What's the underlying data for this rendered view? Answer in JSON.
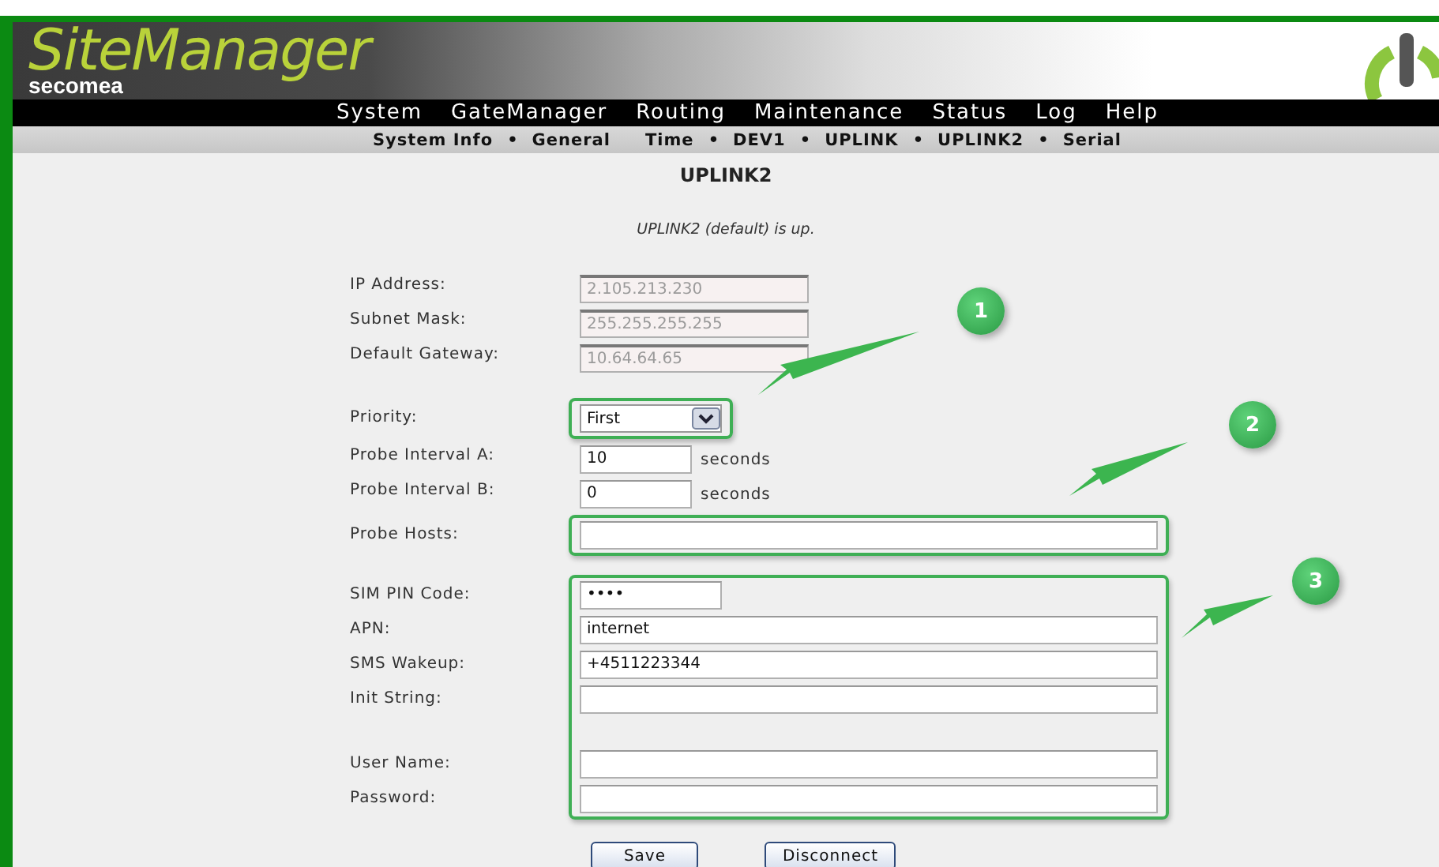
{
  "header": {
    "logo_title": "SiteManager",
    "logo_brand": "secomea"
  },
  "menu": [
    "System",
    "GateManager",
    "Routing",
    "Maintenance",
    "Status",
    "Log",
    "Help"
  ],
  "submenu": [
    {
      "label": "System Info"
    },
    {
      "label": "General",
      "bullet_before": "•"
    },
    {
      "label": "Time"
    },
    {
      "label": "DEV1",
      "bullet_before": "•"
    },
    {
      "label": "UPLINK",
      "bullet_before": "•"
    },
    {
      "label": "UPLINK2",
      "bullet_before": "•"
    },
    {
      "label": "Serial",
      "bullet_before": "•"
    }
  ],
  "page_title": "UPLINK2",
  "status_message": "UPLINK2 (default) is up.",
  "form_groups": [
    {
      "kind": "fields",
      "highlighted": false,
      "rows": [
        {
          "kind": "readonly",
          "label": "IP Address:",
          "value": "2.105.213.230"
        },
        {
          "kind": "readonly",
          "label": "Subnet Mask:",
          "value": "255.255.255.255"
        },
        {
          "kind": "readonly",
          "label": "Default Gateway:",
          "value": "10.64.64.65"
        }
      ]
    },
    {
      "kind": "spacer"
    },
    {
      "kind": "fields",
      "highlighted": true,
      "rows": [
        {
          "kind": "select",
          "label": "Priority:",
          "value": "First"
        }
      ]
    },
    {
      "kind": "fields",
      "highlighted": false,
      "rows": [
        {
          "kind": "interval",
          "label": "Probe Interval A:",
          "value": "10",
          "unit": "seconds"
        },
        {
          "kind": "interval",
          "label": "Probe Interval B:",
          "value": "0",
          "unit": "seconds"
        }
      ]
    },
    {
      "kind": "fields",
      "highlighted": true,
      "rows": [
        {
          "kind": "text",
          "label": "Probe Hosts:"
        }
      ]
    },
    {
      "kind": "spacer"
    },
    {
      "kind": "fields",
      "highlighted": true,
      "rows": [
        {
          "kind": "pin",
          "label": "SIM PIN Code:",
          "value": "••••"
        },
        {
          "kind": "text",
          "label": "APN:",
          "value": "internet"
        },
        {
          "kind": "text",
          "label": "SMS Wakeup:",
          "value": "+4511223344"
        },
        {
          "kind": "text",
          "label": "Init String:"
        },
        {
          "kind": "spacer"
        },
        {
          "kind": "text",
          "label": "User Name:"
        },
        {
          "kind": "text",
          "label": "Password:"
        }
      ]
    }
  ],
  "buttons": [
    "Save",
    "Disconnect"
  ],
  "callouts": [
    {
      "number": "1"
    },
    {
      "number": "2"
    },
    {
      "number": "3"
    }
  ]
}
